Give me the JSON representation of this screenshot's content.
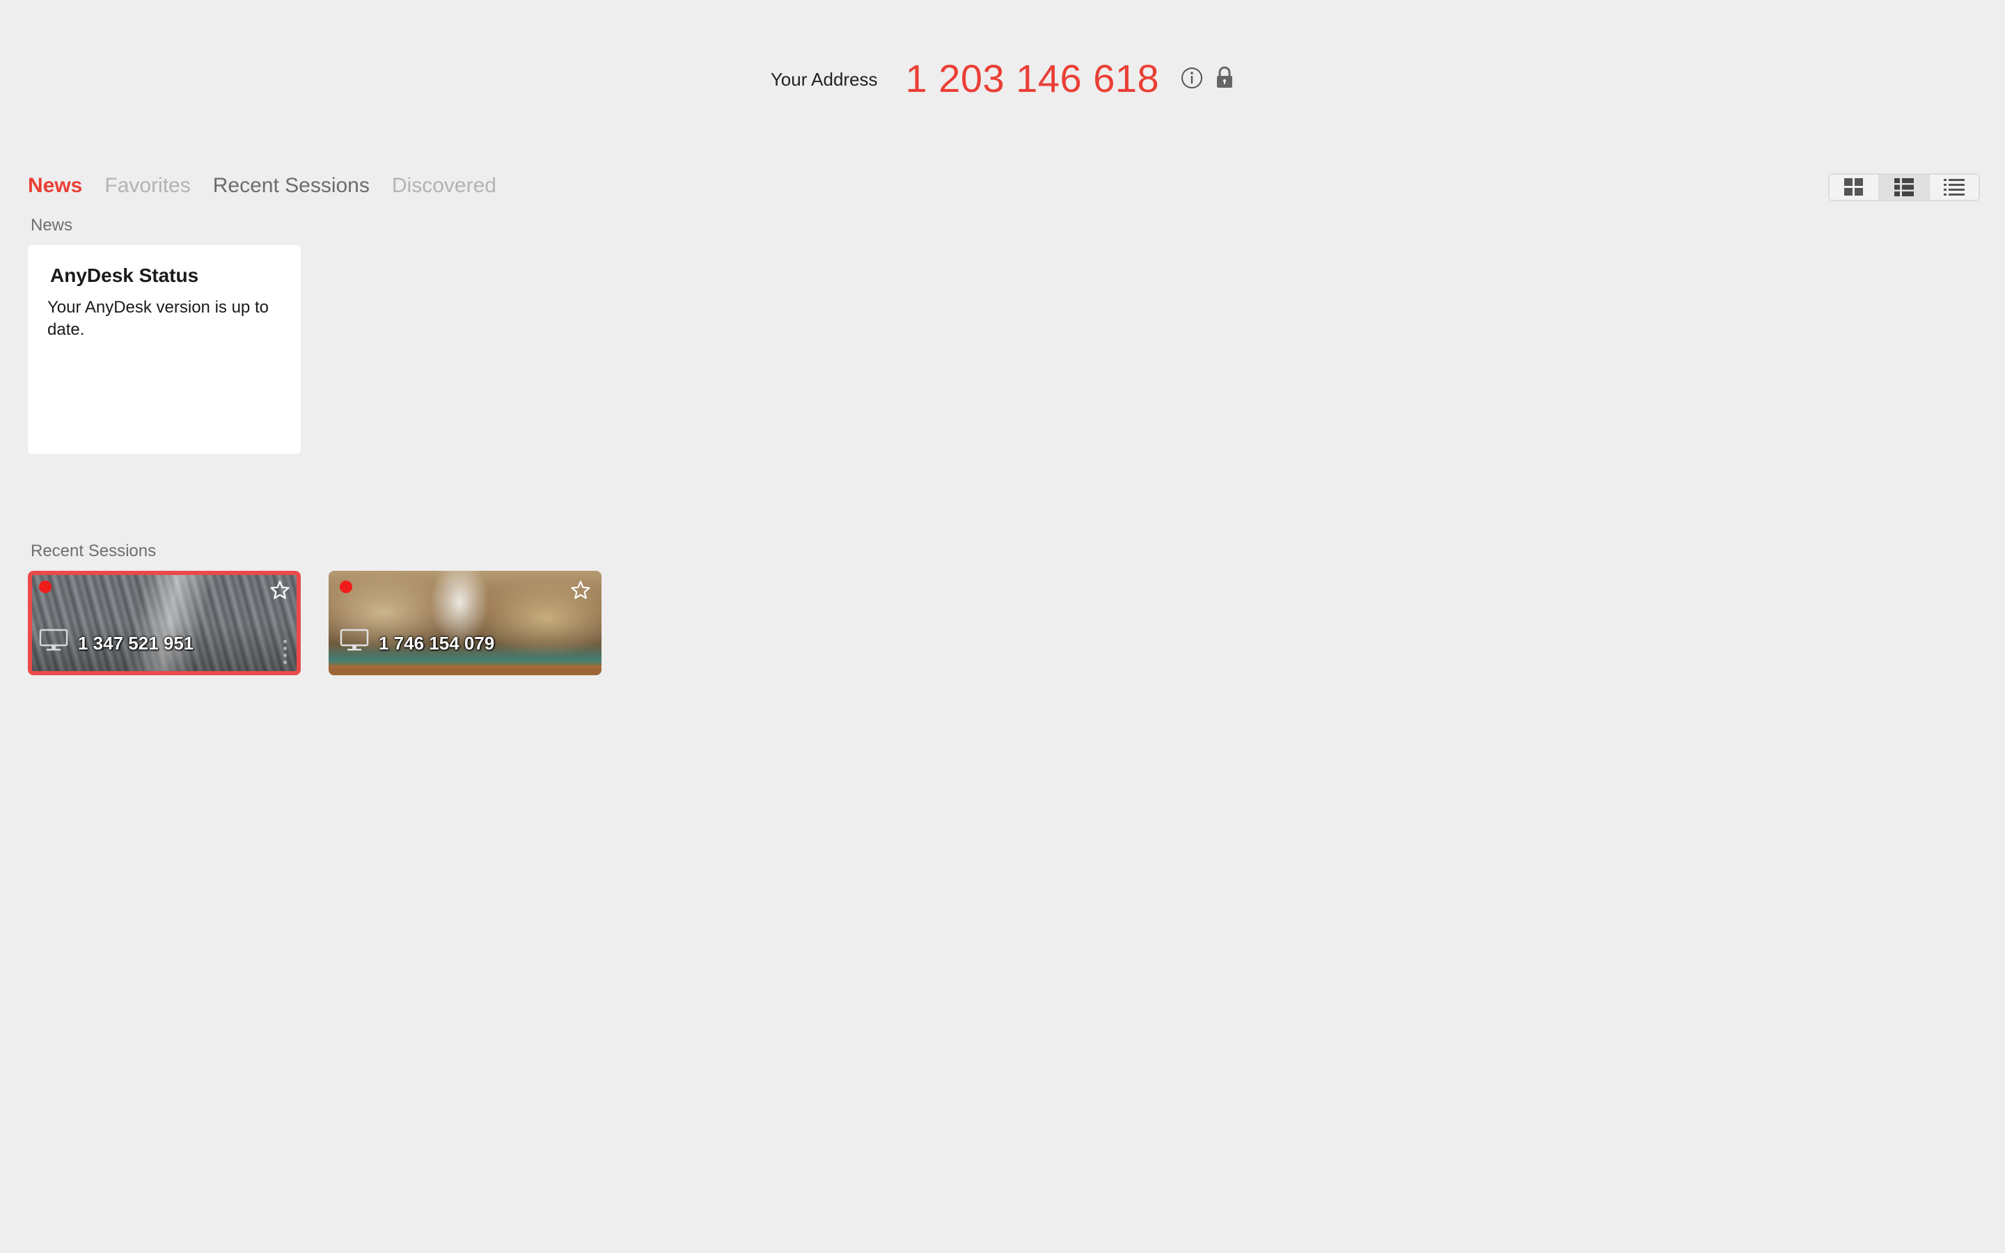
{
  "header": {
    "address_label": "Your Address",
    "address_value": "1 203 146 618",
    "icons": [
      "info-icon",
      "lock-icon"
    ]
  },
  "tabs": [
    {
      "label": "News",
      "state": "active"
    },
    {
      "label": "Favorites",
      "state": "disabled"
    },
    {
      "label": "Recent Sessions",
      "state": "normal"
    },
    {
      "label": "Discovered",
      "state": "disabled"
    }
  ],
  "view_toggle": {
    "options": [
      "tile-view-icon",
      "detail-view-icon",
      "list-view-icon"
    ],
    "selected": "detail-view-icon"
  },
  "news": {
    "section_label": "News",
    "card": {
      "title": "AnyDesk Status",
      "body": "Your AnyDesk version is up to date."
    }
  },
  "recent_sessions": {
    "section_label": "Recent Sessions",
    "items": [
      {
        "id": "1 347 521 951",
        "status": "offline",
        "selected": true,
        "icons": [
          "status-dot",
          "star-icon",
          "monitor-icon"
        ]
      },
      {
        "id": "1 746 154 079",
        "status": "offline",
        "selected": false,
        "icons": [
          "status-dot",
          "star-icon",
          "monitor-icon"
        ]
      }
    ]
  },
  "colors": {
    "accent": "#ea3f36",
    "background": "#eeeeee",
    "selection_border": "#ea4a4a",
    "status_offline": "#f01c1c"
  }
}
